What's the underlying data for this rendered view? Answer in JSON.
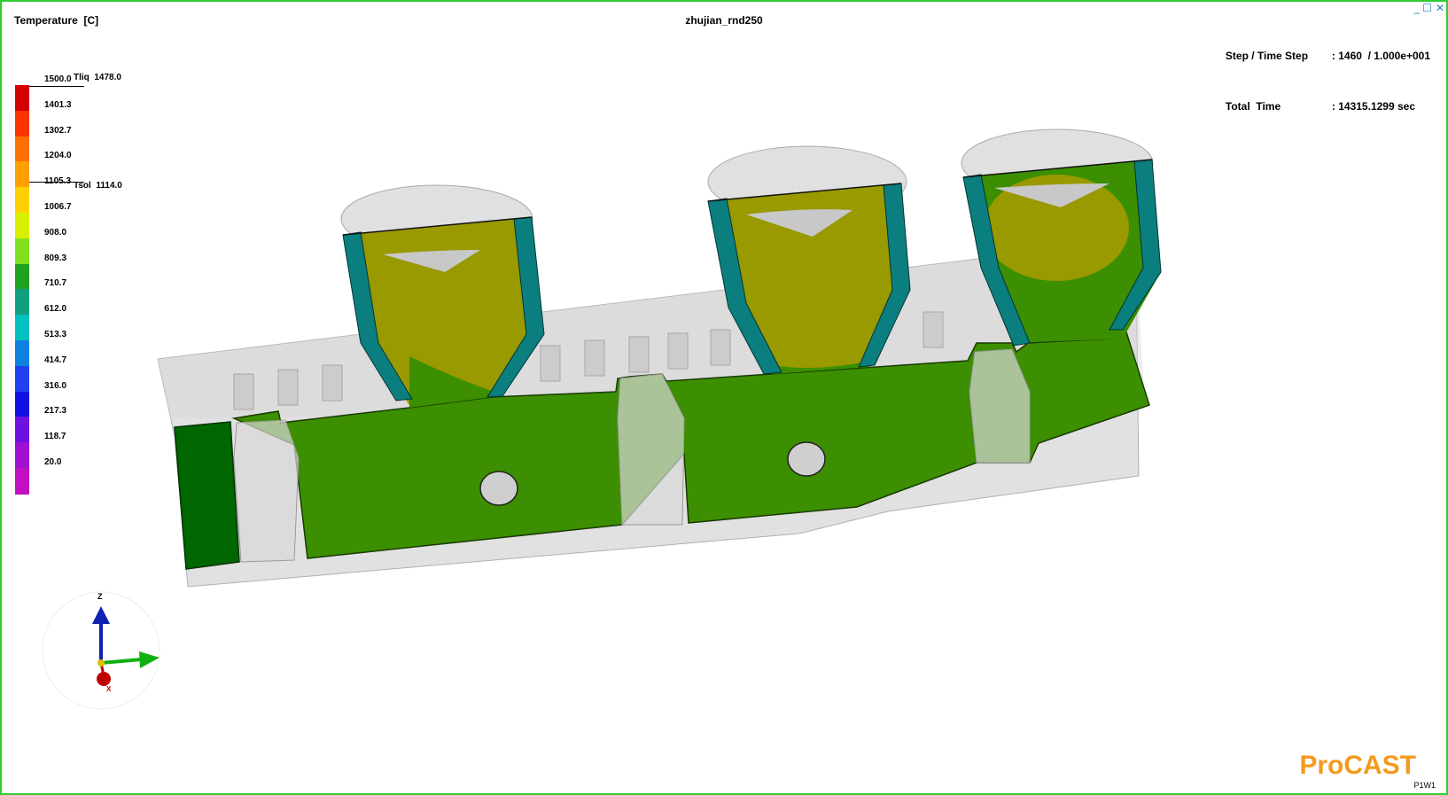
{
  "header": {
    "variable_title": "Temperature  [C]",
    "model_name": "zhujian_rnd250",
    "step_label": "Step / Time Step",
    "step_value": ": 1460  / 1.000e+001",
    "total_time_label": "Total  Time",
    "total_time_value": ": 14315.1299 sec"
  },
  "legend": {
    "ticks": [
      "1500.0",
      "1401.3",
      "1302.7",
      "1204.0",
      "1105.3",
      "1006.7",
      "908.0",
      "809.3",
      "710.7",
      "612.0",
      "513.3",
      "414.7",
      "316.0",
      "217.3",
      "118.7",
      "20.0"
    ],
    "colors": [
      "#d40000",
      "#ff3300",
      "#ff7000",
      "#ffa000",
      "#ffd000",
      "#d8f000",
      "#80e020",
      "#20a020",
      "#10a080",
      "#00c0c0",
      "#1080e0",
      "#2040f0",
      "#1010e0",
      "#7010e0",
      "#a010d0",
      "#c010c0"
    ],
    "tliq_label": "Tliq",
    "tliq_value": "1478.0",
    "tsol_label": "Tsol",
    "tsol_value": "1114.0"
  },
  "triad": {
    "z_label": "Z",
    "y_label": "Y",
    "x_label": "X"
  },
  "branding": {
    "product": "ProCAST",
    "window_id": "P1W1"
  },
  "window_controls": [
    "_",
    "☐",
    "✕"
  ],
  "colors": {
    "solid": "#3c8f00",
    "mushy": "#999900",
    "shell": "#0b7f7f",
    "mold": "#c8c8c8",
    "frame": "#2ecc2e",
    "brand": "#f39a1e"
  }
}
